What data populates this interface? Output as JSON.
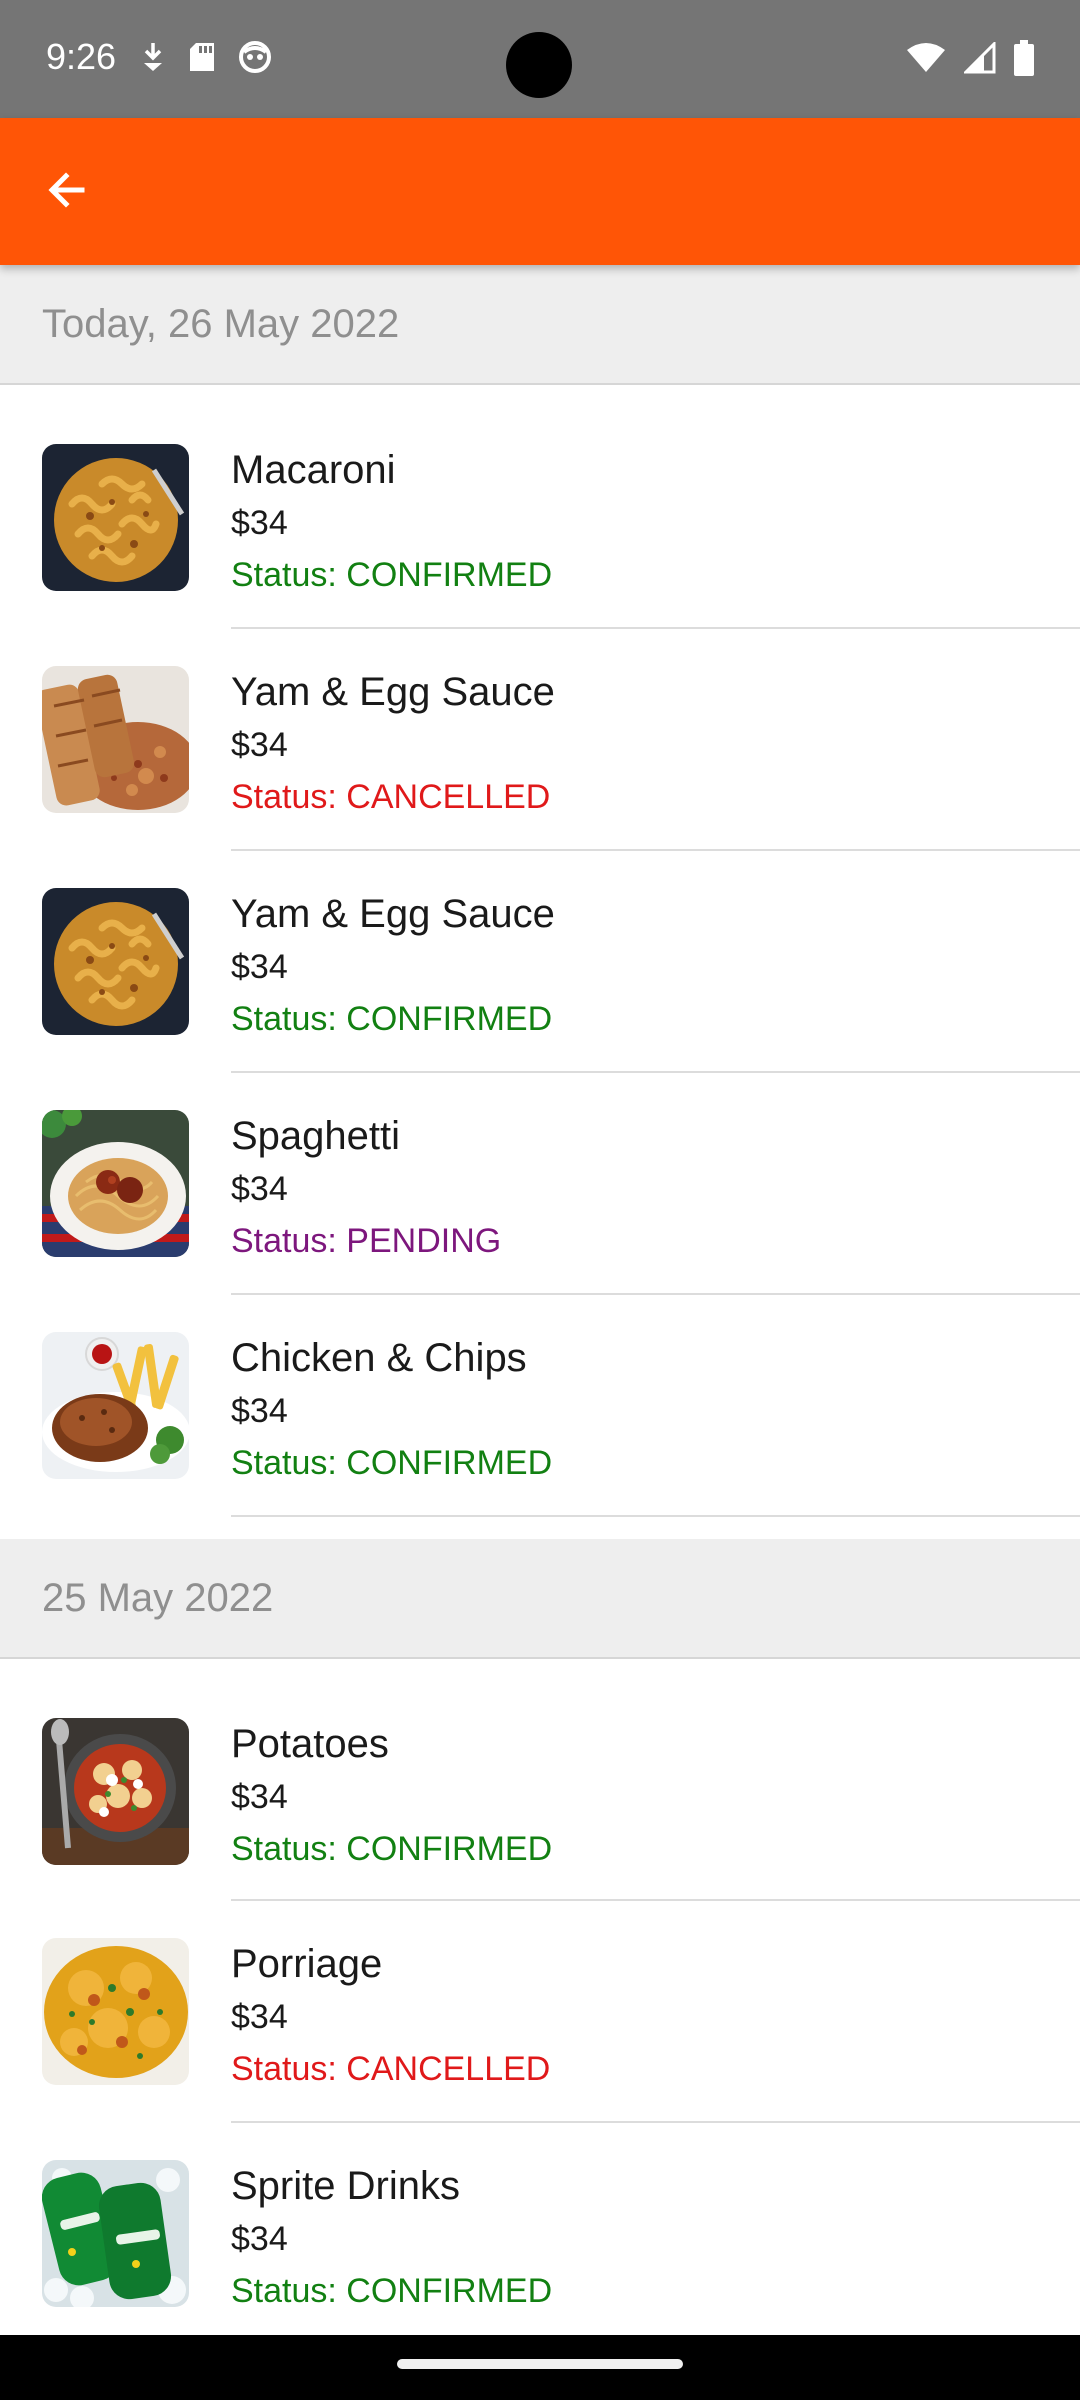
{
  "status_bar": {
    "time": "9:26",
    "left_icons": [
      "download-icon",
      "sd-card-icon",
      "face-icon"
    ],
    "right_icons": [
      "wifi-icon",
      "cellular-signal-icon",
      "battery-icon"
    ]
  },
  "app_bar": {
    "back_icon": "arrow-back-icon",
    "accent_color": "#ff5506"
  },
  "sections": [
    {
      "header": "Today, 26 May 2022",
      "orders": [
        {
          "name": "Macaroni",
          "price": "$34",
          "status": "Status: CONFIRMED",
          "status_type": "confirmed",
          "image": "macaroni"
        },
        {
          "name": "Yam & Egg Sauce",
          "price": "$34",
          "status": "Status: CANCELLED",
          "status_type": "cancelled",
          "image": "yam-egg"
        },
        {
          "name": "Yam & Egg Sauce",
          "price": "$34",
          "status": "Status: CONFIRMED",
          "status_type": "confirmed",
          "image": "macaroni"
        },
        {
          "name": "Spaghetti",
          "price": "$34",
          "status": "Status: PENDING",
          "status_type": "pending",
          "image": "spaghetti"
        },
        {
          "name": "Chicken & Chips",
          "price": "$34",
          "status": "Status: CONFIRMED",
          "status_type": "confirmed",
          "image": "chicken"
        }
      ]
    },
    {
      "header": "25 May 2022",
      "orders": [
        {
          "name": "Potatoes",
          "price": "$34",
          "status": "Status: CONFIRMED",
          "status_type": "confirmed",
          "image": "potatoes"
        },
        {
          "name": "Porriage",
          "price": "$34",
          "status": "Status: CANCELLED",
          "status_type": "cancelled",
          "image": "porriage"
        },
        {
          "name": "Sprite Drinks",
          "price": "$34",
          "status": "Status: CONFIRMED",
          "status_type": "confirmed",
          "image": "sprite"
        }
      ]
    }
  ],
  "colors": {
    "confirmed": "#128012",
    "cancelled": "#e0191a",
    "pending": "#7d177d",
    "header_bg": "#eeeeee",
    "status_bar_bg": "#757575"
  }
}
